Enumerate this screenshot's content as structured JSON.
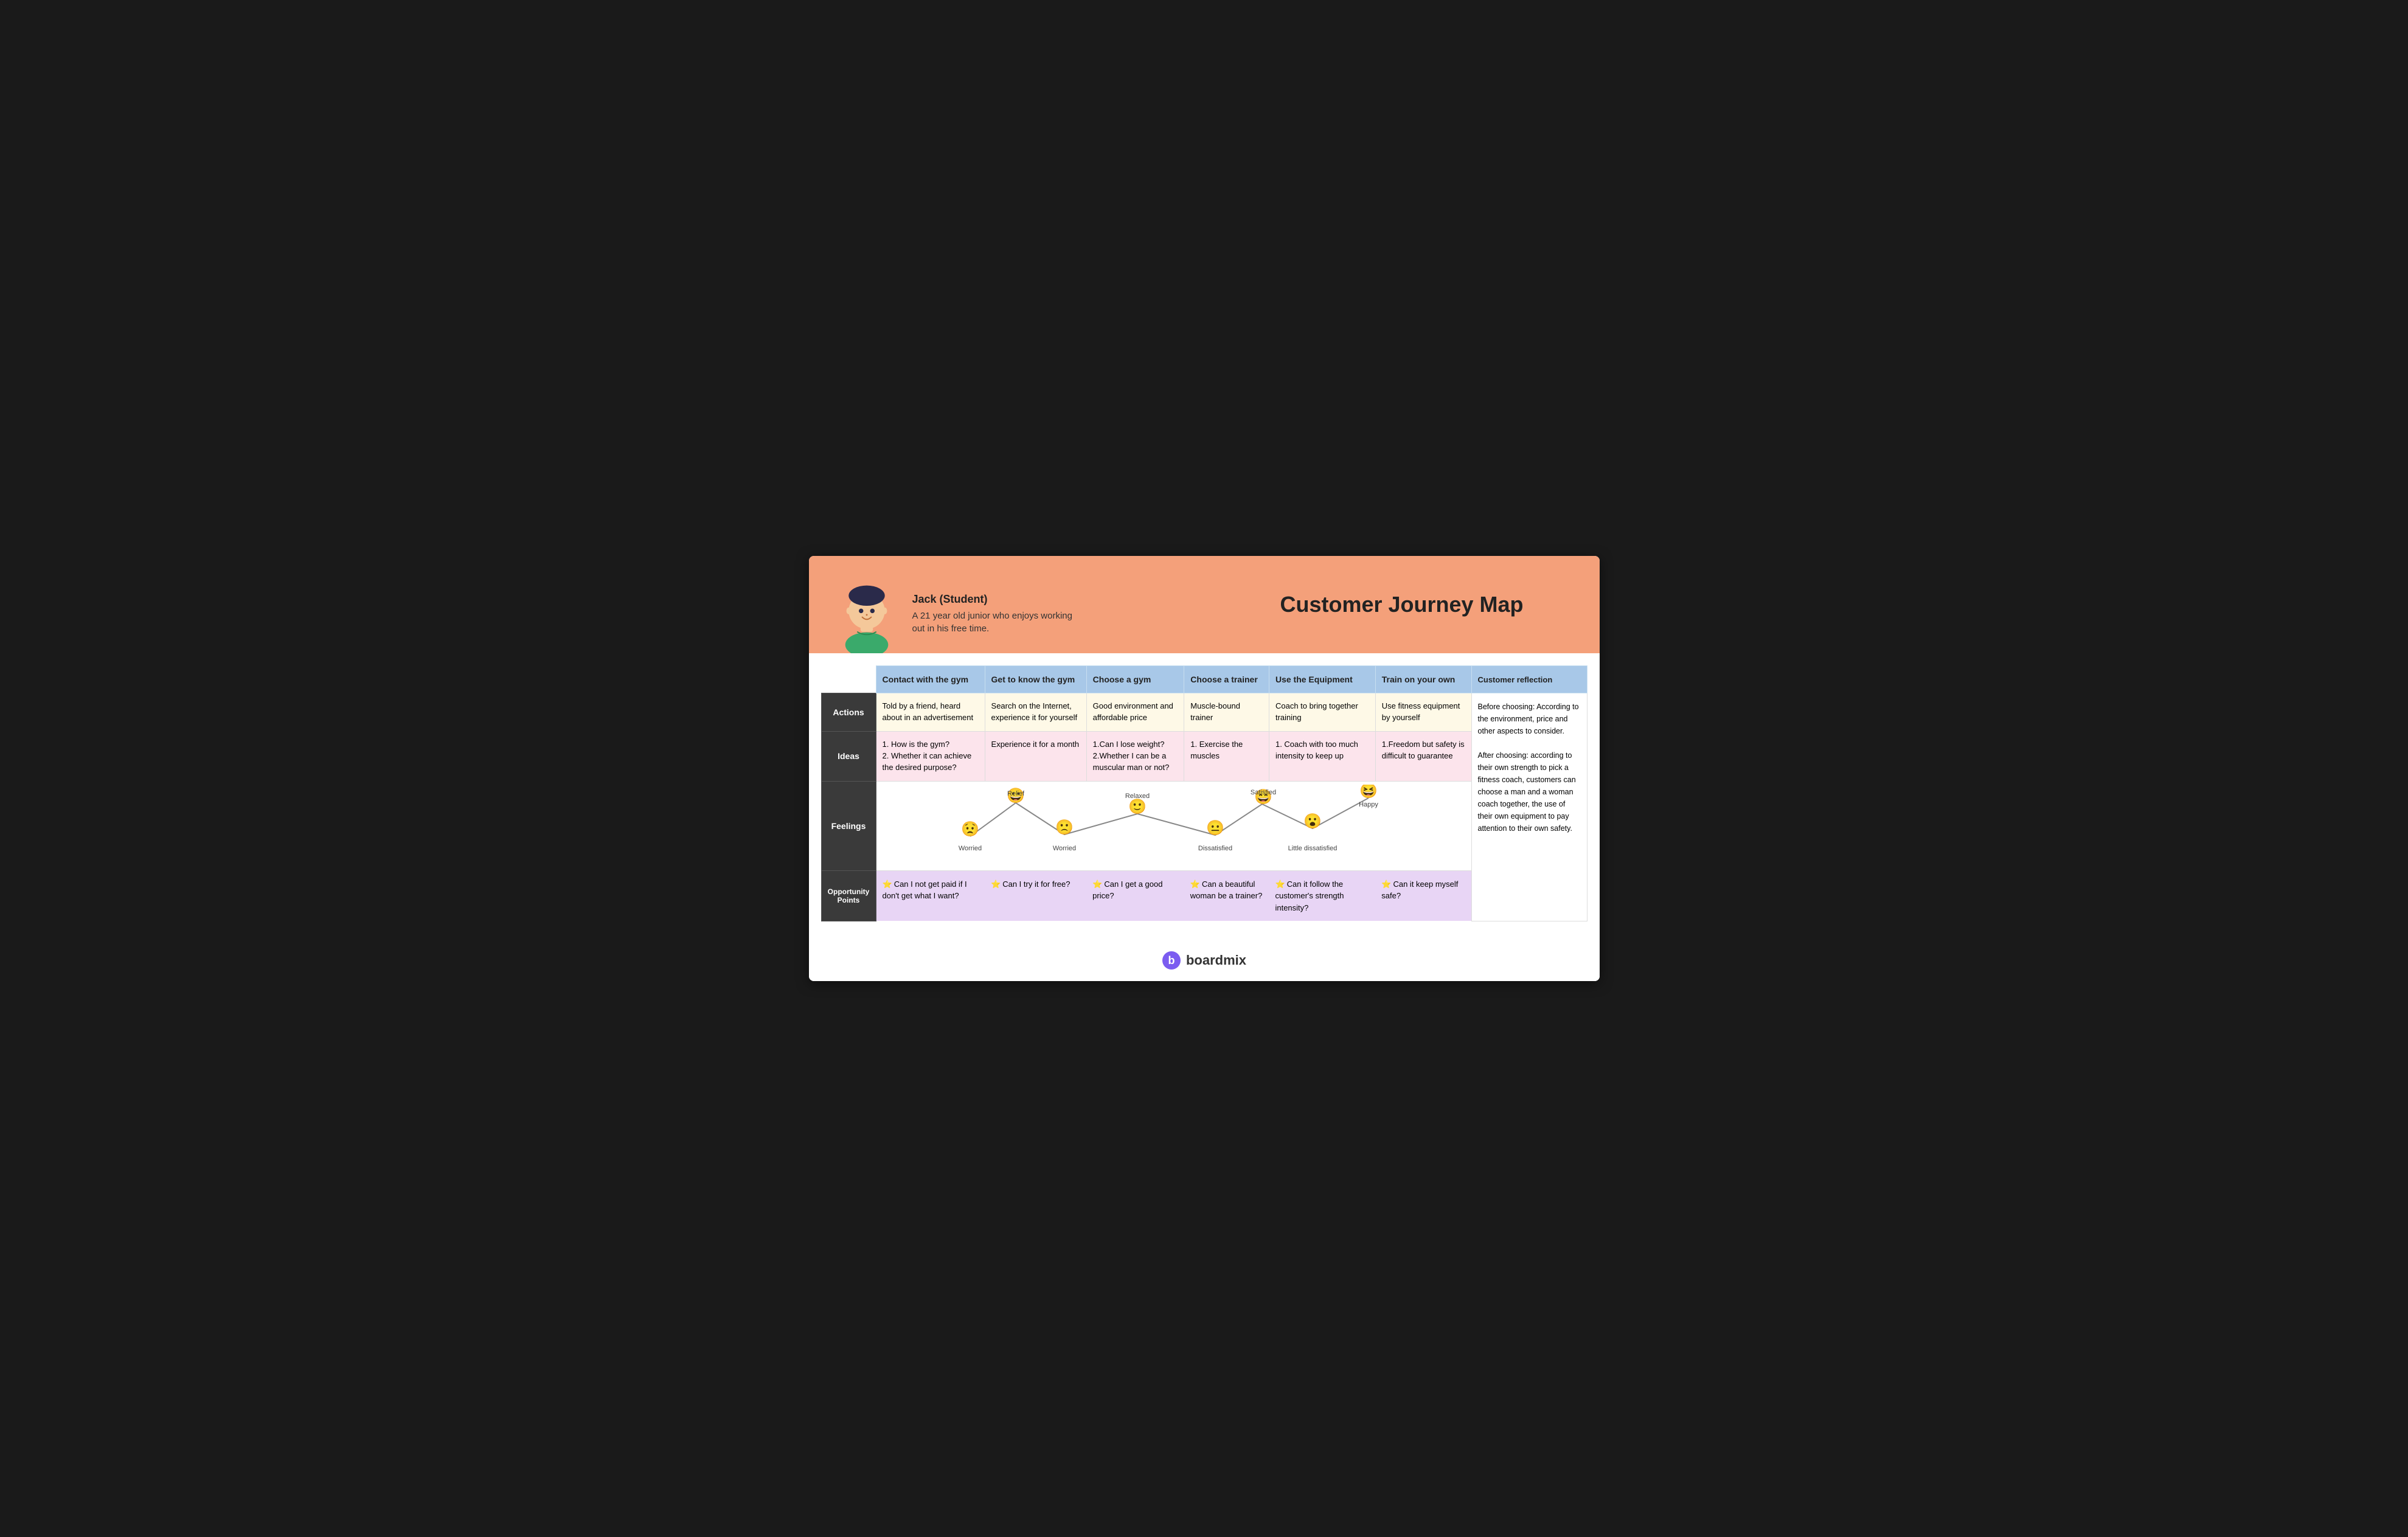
{
  "header": {
    "persona_name": "Jack (Student)",
    "persona_desc": "A 21 year old junior who enjoys working\nout in his free time.",
    "title": "Customer Journey Map"
  },
  "columns": [
    {
      "id": "contact",
      "label": "Contact with the gym"
    },
    {
      "id": "gettoknow",
      "label": "Get to know the gym"
    },
    {
      "id": "choosegym",
      "label": "Choose a gym"
    },
    {
      "id": "choosetrainer",
      "label": "Choose a trainer"
    },
    {
      "id": "equipment",
      "label": "Use the Equipment"
    },
    {
      "id": "trainown",
      "label": "Train on your own"
    },
    {
      "id": "reflection",
      "label": "Customer reflection"
    }
  ],
  "rows": {
    "actions": {
      "label": "Actions",
      "cells": [
        "Told by a friend, heard about in an advertisement",
        "Search on the Internet, experience it for yourself",
        "Good environment and affordable price",
        "Muscle-bound trainer",
        "Coach to bring together training",
        "Use fitness equipment by yourself",
        ""
      ]
    },
    "ideas": {
      "label": "Ideas",
      "cells": [
        "1. How is the gym?\n2. Whether it can achieve the desired purpose?",
        "Experience it for a month",
        "1.Can I lose weight?\n2.Whether I can be a muscular man or not?",
        "1. Exercise the muscles",
        "1. Coach with too much intensity to keep up",
        "1.Freedom but safety is difficult to guarantee",
        ""
      ]
    },
    "feelings": {
      "label": "Feelings",
      "points": [
        {
          "name": "Worried",
          "emoji": "😟",
          "level": 2
        },
        {
          "name": "Relief",
          "emoji": "😀",
          "level": 4
        },
        {
          "name": "Worried",
          "emoji": "🙁",
          "level": 2
        },
        {
          "name": "Relaxed",
          "emoji": "🙂",
          "level": 3.5
        },
        {
          "name": "Dissatisfied",
          "emoji": "😐",
          "level": 2
        },
        {
          "name": "Satisfied",
          "emoji": "😄",
          "level": 4
        },
        {
          "name": "Little dissatisfied",
          "emoji": "😮",
          "level": 2.5
        },
        {
          "name": "Happy",
          "emoji": "😆",
          "level": 4.5
        }
      ]
    },
    "opportunity": {
      "label": "Opportunity Points",
      "cells": [
        "⭐Can I not get paid if I don't get what I want?",
        "⭐Can I try it for free?",
        "⭐Can I get a good price?",
        "⭐Can a beautiful woman be a trainer?",
        "⭐Can it follow the customer's strength intensity?",
        "⭐Can it keep myself safe?",
        ""
      ]
    }
  },
  "reflection_text": "Before choosing: According to the environment, price and other aspects to consider.\n\nAfter choosing: according to their own strength to pick a fitness coach, customers can choose a man and a woman coach together, the use of their own equipment to pay attention to their own safety.",
  "footer": {
    "brand": "boardmix"
  }
}
